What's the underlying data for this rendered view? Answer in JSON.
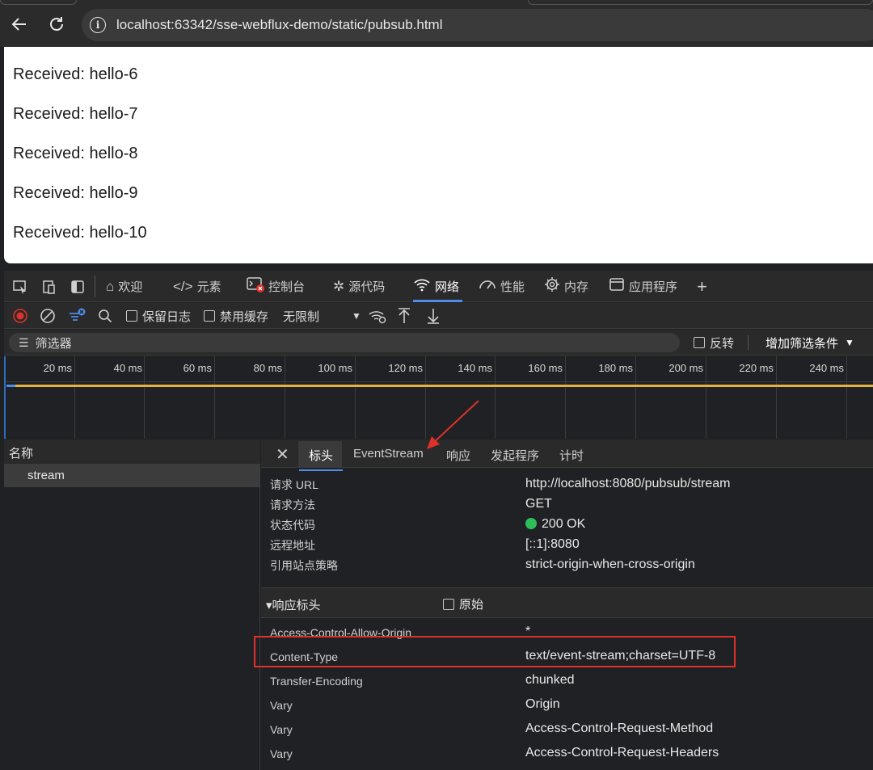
{
  "browser": {
    "url": "localhost:63342/sse-webflux-demo/static/pubsub.html"
  },
  "page": {
    "messages": [
      "Received: hello-6",
      "Received: hello-7",
      "Received: hello-8",
      "Received: hello-9",
      "Received: hello-10"
    ]
  },
  "devtools": {
    "tabs": [
      {
        "label": "欢迎",
        "icon": "home-icon"
      },
      {
        "label": "元素",
        "icon": "code-icon"
      },
      {
        "label": "控制台",
        "icon": "console-icon"
      },
      {
        "label": "源代码",
        "icon": "bug-icon"
      },
      {
        "label": "网络",
        "icon": "wifi-icon",
        "active": true
      },
      {
        "label": "性能",
        "icon": "gauge-icon"
      },
      {
        "label": "内存",
        "icon": "chip-icon"
      },
      {
        "label": "应用程序",
        "icon": "app-icon"
      }
    ],
    "toolbar": {
      "preserve_log": "保留日志",
      "disable_cache": "禁用缓存",
      "throttling": "无限制"
    },
    "filter": {
      "placeholder": "筛选器",
      "invert": "反转",
      "more_filters": "增加筛选条件"
    },
    "timeline": {
      "ticks": [
        "20 ms",
        "40 ms",
        "60 ms",
        "80 ms",
        "100 ms",
        "120 ms",
        "140 ms",
        "160 ms",
        "180 ms",
        "200 ms",
        "220 ms",
        "240 ms"
      ]
    },
    "request_list": {
      "header": "名称",
      "rows": [
        "stream"
      ]
    },
    "detail": {
      "tabs": [
        "标头",
        "EventStream",
        "响应",
        "发起程序",
        "计时"
      ],
      "general": [
        {
          "key": "请求 URL",
          "value": "http://localhost:8080/pubsub/stream"
        },
        {
          "key": "请求方法",
          "value": "GET"
        },
        {
          "key": "状态代码",
          "value": "200 OK"
        },
        {
          "key": "远程地址",
          "value": "[::1]:8080"
        },
        {
          "key": "引用站点策略",
          "value": "strict-origin-when-cross-origin"
        }
      ],
      "response_headers_title": "▾响应标头",
      "raw_label": "原始",
      "response_headers": [
        {
          "key": "Access-Control-Allow-Origin",
          "value": "*"
        },
        {
          "key": "Content-Type",
          "value": "text/event-stream;charset=UTF-8"
        },
        {
          "key": "Transfer-Encoding",
          "value": "chunked"
        },
        {
          "key": "Vary",
          "value": "Origin"
        },
        {
          "key": "Vary",
          "value": "Access-Control-Request-Method"
        },
        {
          "key": "Vary",
          "value": "Access-Control-Request-Headers"
        }
      ]
    }
  },
  "colors": {
    "accent": "#4f8de8",
    "status_ok": "#2dbe5a",
    "highlight": "#e0302a",
    "waterfall": "#e3b341"
  }
}
